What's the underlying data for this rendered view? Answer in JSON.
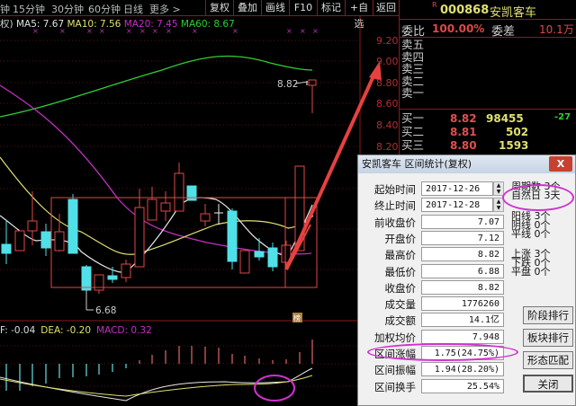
{
  "toolbar": {
    "tabs": [
      "钟",
      "15分钟",
      "30分钟",
      "60分钟",
      "日线",
      "更多 >"
    ],
    "buttons": [
      "复权",
      "叠加",
      "画线",
      "F10",
      "标记",
      "+自选",
      "返回"
    ]
  },
  "ma_legend": {
    "prefix": "权)",
    "ma5": "MA5: 7.67",
    "ma10": "MA10: 7.56",
    "ma20": "MA20: 7.45",
    "ma60": "MA60: 8.67"
  },
  "colors": {
    "ma5": "#e0e0e0",
    "ma10": "#e0e070",
    "ma20": "#c030c0",
    "ma60": "#30d030",
    "up": "#e04848",
    "down": "#50e0e8"
  },
  "price_axis": [
    "9.20",
    "9.00",
    "8.80",
    "8.60",
    "8.40",
    "8.20"
  ],
  "chart_labels": {
    "high": "8.82",
    "low": "6.68",
    "marker": "榜"
  },
  "macd": {
    "dif": "F: -0.04",
    "dea": "DEA: -0.20",
    "macd": "MACD: 0.32"
  },
  "quote": {
    "badge": "R",
    "code": "000868",
    "name": "安凯客车",
    "weibi_label": "委比",
    "weibi": "100.00%",
    "weicha_label": "委差",
    "weicha": "10.1万",
    "asks": [
      "卖五",
      "卖四",
      "卖三",
      "卖二",
      "卖一"
    ],
    "bids": [
      {
        "label": "买一",
        "price": "8.82",
        "vol": "98455",
        "chg": "-27"
      },
      {
        "label": "买二",
        "price": "8.81",
        "vol": "502",
        "chg": ""
      },
      {
        "label": "买三",
        "price": "8.80",
        "vol": "1593",
        "chg": ""
      }
    ]
  },
  "dialog": {
    "title": "安凯客车 区间统计(复权)",
    "close": "X",
    "rows": [
      {
        "label": "起始时间",
        "value": "2017-12-26"
      },
      {
        "label": "终止时间",
        "value": "2017-12-28"
      },
      {
        "label": "前收盘价",
        "value": "7.07"
      },
      {
        "label": "开盘价",
        "value": "7.12"
      },
      {
        "label": "最高价",
        "value": "8.82"
      },
      {
        "label": "最低价",
        "value": "6.88"
      },
      {
        "label": "收盘价",
        "value": "8.82"
      },
      {
        "label": "成交量",
        "value": "1776260"
      },
      {
        "label": "成交额",
        "value": "14.1亿"
      },
      {
        "label": "加权均价",
        "value": "7.948"
      },
      {
        "label": "区间涨幅",
        "value": "1.75(24.75%)"
      },
      {
        "label": "区间振幅",
        "value": "1.94(28.20%)"
      },
      {
        "label": "区间换手",
        "value": "25.54%"
      }
    ],
    "stats": [
      "周期数 3个",
      "自然日 3天",
      "阳线 3个",
      "阴线 0个",
      "平线 0个",
      "上涨 3个",
      "下跌 0个",
      "平盘 0个"
    ],
    "buttons": [
      "阶段排行",
      "板块排行",
      "形态匹配",
      "关闭"
    ]
  }
}
